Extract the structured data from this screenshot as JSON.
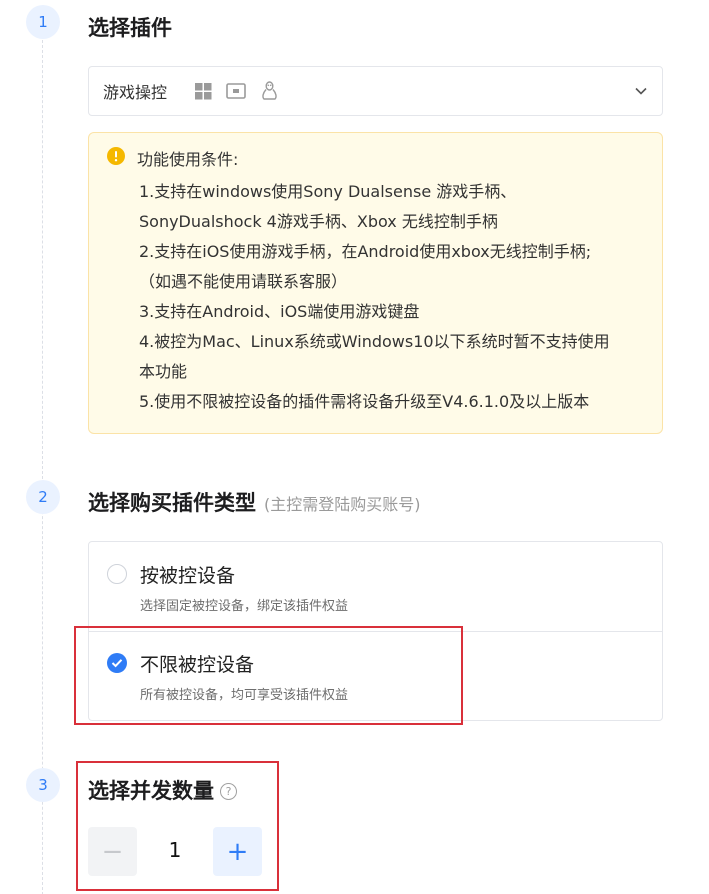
{
  "steps": [
    {
      "number": "1",
      "title": "选择插件"
    },
    {
      "number": "2",
      "title": "选择购买插件类型",
      "subtitle": "(主控需登陆购买账号)"
    },
    {
      "number": "3",
      "title": "选择并发数量"
    }
  ],
  "plugin_select": {
    "value": "游戏操控",
    "platform_icons": [
      "windows-icon",
      "tv-icon",
      "linux-icon"
    ],
    "chevron": "chevron-down-icon"
  },
  "notice": {
    "icon": "warning-circle-icon",
    "title": "功能使用条件:",
    "lines": [
      "1.支持在windows使用Sony Dualsense 游戏手柄、",
      "SonyDualshock 4游戏手柄、Xbox 无线控制手柄",
      "2.支持在iOS使用游戏手柄，在Android使用xbox无线控制手柄;",
      "（如遇不能使用请联系客服）",
      "3.支持在Android、iOS端使用游戏键盘",
      "4.被控为Mac、Linux系统或Windows10以下系统时暂不支持使用",
      "本功能",
      "5.使用不限被控设备的插件需将设备升级至V4.6.1.0及以上版本"
    ]
  },
  "purchase_options": [
    {
      "title": "按被控设备",
      "desc": "选择固定被控设备，绑定该插件权益",
      "selected": false
    },
    {
      "title": "不限被控设备",
      "desc": "所有被控设备，均可享受该插件权益",
      "selected": true
    }
  ],
  "quantity": {
    "value": "1",
    "minus": "−",
    "plus": "+",
    "help": "?"
  },
  "colors": {
    "accent": "#2f7cf6",
    "warning": "#f5b800",
    "highlight": "#d9303a",
    "notice_bg": "#fffbe8"
  }
}
